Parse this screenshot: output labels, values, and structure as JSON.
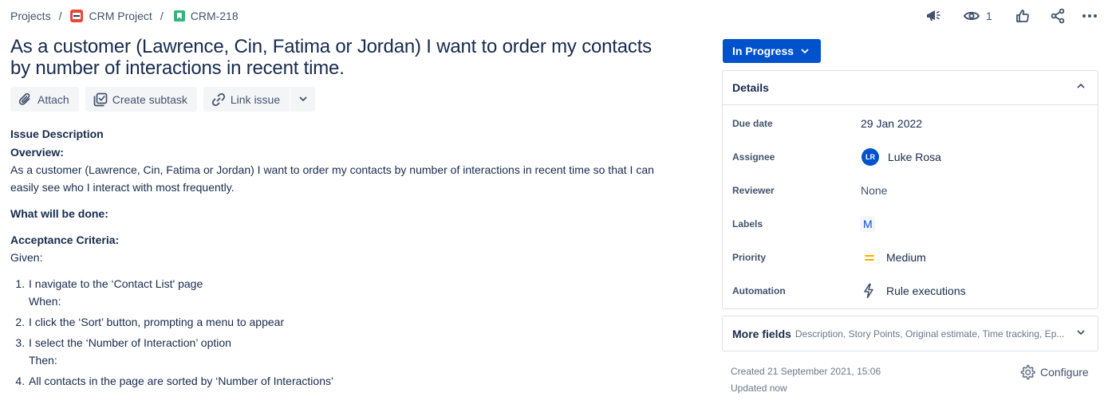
{
  "breadcrumb": {
    "projects": "Projects",
    "separator": "/",
    "project": "CRM Project",
    "issue_key": "CRM-218"
  },
  "header": {
    "watch_count": "1"
  },
  "issue": {
    "title": "As a customer (Lawrence, Cin, Fatima or Jordan) I want to order my contacts by number of interactions in recent time."
  },
  "toolbar": {
    "attach": "Attach",
    "create_subtask": "Create subtask",
    "link_issue": "Link issue"
  },
  "description": {
    "section_title": "Issue Description",
    "overview_heading": "Overview:",
    "overview_text": "As a customer (Lawrence, Cin, Fatima or Jordan) I want to order my contacts by number of interactions in recent time so that I can easily see who I interact with most frequently.",
    "done_heading": "What will be done:",
    "criteria_heading": "Acceptance Criteria:",
    "given": "Given:",
    "steps": [
      {
        "text": "I navigate to the ‘Contact List' page",
        "after": "When:"
      },
      {
        "text": "I click the ‘Sort’ button, prompting a menu to appear",
        "after": ""
      },
      {
        "text": "I select the ‘Number of Interaction’ option",
        "after": "Then:"
      },
      {
        "text": "All contacts in the page are sorted by ‘Number of Interactions’",
        "after": ""
      }
    ]
  },
  "status": {
    "label": "In Progress",
    "color": "#0052cc"
  },
  "details": {
    "title": "Details",
    "rows": {
      "due_date": {
        "label": "Due date",
        "value": "29 Jan 2022"
      },
      "assignee": {
        "label": "Assignee",
        "value": "Luke Rosa",
        "initials": "LR"
      },
      "reviewer": {
        "label": "Reviewer",
        "value": "None"
      },
      "labels": {
        "label": "Labels",
        "value": "M"
      },
      "priority": {
        "label": "Priority",
        "value": "Medium",
        "color": "#ffab00"
      },
      "automation": {
        "label": "Automation",
        "value": "Rule executions"
      }
    }
  },
  "more_fields": {
    "title": "More fields",
    "list": "Description, Story Points, Original estimate, Time tracking, Ep..."
  },
  "meta": {
    "created": "Created 21 September 2021, 15:06",
    "updated": "Updated now",
    "configure": "Configure"
  }
}
